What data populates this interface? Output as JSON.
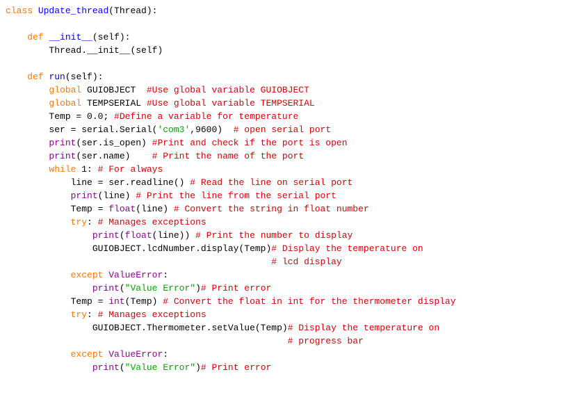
{
  "code": {
    "l01": {
      "kw": "class",
      "name": "Update_thread",
      "rest": "(Thread):"
    },
    "l03": {
      "kw": "def",
      "name": "__init__",
      "rest": "(self):"
    },
    "l04": {
      "t": "Thread.__init__(self)"
    },
    "l06": {
      "kw": "def",
      "name": "run",
      "rest": "(self):"
    },
    "l07": {
      "kw": "global",
      "rest": " GUIOBJECT  ",
      "c": "#Use global variable GUIOBJECT"
    },
    "l08": {
      "kw": "global",
      "rest": " TEMPSERIAL ",
      "c": "#Use global variable TEMPSERIAL"
    },
    "l09": {
      "a": "Temp = ",
      "n": "0.0",
      "b": "; ",
      "c": "#Define a variable for temperature"
    },
    "l10": {
      "a": "ser = serial.Serial(",
      "s": "'com3'",
      "b": ",",
      "n": "9600",
      "d": ")  ",
      "c": "# open serial port"
    },
    "l11": {
      "bi": "print",
      "a": "(ser.is_open) ",
      "c": "#Print and check if the port is open"
    },
    "l12": {
      "bi": "print",
      "a": "(ser.name)    ",
      "c": "# Print the name of the port"
    },
    "l13": {
      "kw": "while",
      "n": " 1",
      "b": ": ",
      "c": "# For always"
    },
    "l14": {
      "a": "line = ser.readline() ",
      "c": "# Read the line on serial port"
    },
    "l15": {
      "bi": "print",
      "a": "(line) ",
      "c": "# Print the line from the serial port"
    },
    "l16": {
      "a": "Temp = ",
      "bi": "float",
      "b": "(line) ",
      "c": "# Convert the string in float number"
    },
    "l17": {
      "kw": "try",
      "b": ": ",
      "c": "# Manages exceptions"
    },
    "l18": {
      "bi": "print",
      "a": "(",
      "bi2": "float",
      "b": "(line)) ",
      "c": "# Print the number to display"
    },
    "l19": {
      "a": "GUIOBJECT.lcdNumber.display(Temp)",
      "c": "# Display the temperature on"
    },
    "l20": {
      "c": "# lcd display"
    },
    "l21": {
      "kw": "except",
      "bi": "ValueError",
      "b": ":"
    },
    "l22": {
      "bi": "print",
      "a": "(",
      "s": "\"Value Error\"",
      "b": ")",
      "c": "# Print error"
    },
    "l23": {
      "a": "Temp = ",
      "bi": "int",
      "b": "(Temp) ",
      "c": "# Convert the float in int for the thermometer display"
    },
    "l24": {
      "kw": "try",
      "b": ": ",
      "c": "# Manages exceptions"
    },
    "l25": {
      "a": "GUIOBJECT.Thermometer.setValue(Temp)",
      "c": "# Display the temperature on"
    },
    "l26": {
      "c": "# progress bar"
    },
    "l27": {
      "kw": "except",
      "bi": "ValueError",
      "b": ":"
    },
    "l28": {
      "bi": "print",
      "a": "(",
      "s": "\"Value Error\"",
      "b": ")",
      "c": "# Print error"
    }
  }
}
